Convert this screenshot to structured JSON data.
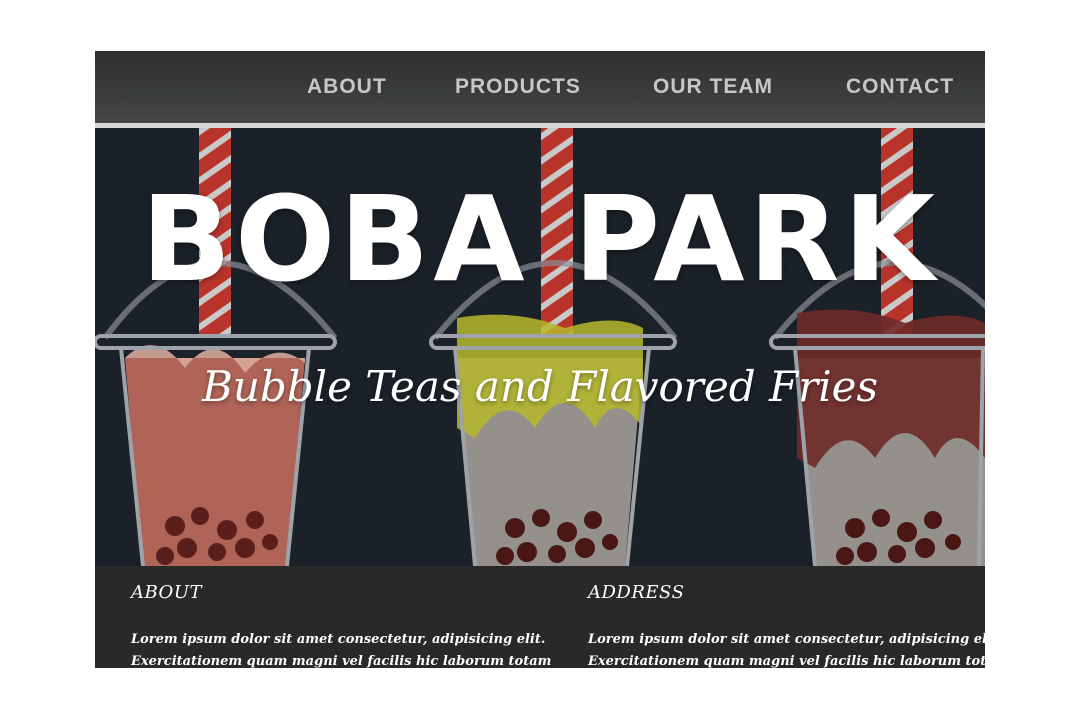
{
  "nav": {
    "items": [
      {
        "label": "ABOUT"
      },
      {
        "label": "PRODUCTS"
      },
      {
        "label": "OUR TEAM"
      },
      {
        "label": "CONTACT"
      }
    ]
  },
  "hero": {
    "title": "BOBA PARK",
    "tagline": "Bubble Teas and Flavored Fries",
    "cups": [
      {
        "flavor": "strawberry",
        "color": "#c9705f"
      },
      {
        "flavor": "matcha",
        "color": "#b6b92a"
      },
      {
        "flavor": "chocolate",
        "color": "#6e2a27"
      }
    ]
  },
  "footer": {
    "about": {
      "heading": "ABOUT",
      "line1": "Lorem ipsum dolor sit amet consectetur, adipisicing elit.",
      "line2": "Exercitationem quam magni vel facilis hic laborum totam"
    },
    "address": {
      "heading": "ADDRESS",
      "line1": "Lorem ipsum dolor sit amet consectetur, adipisicing elit.",
      "line2": "Exercitationem quam magni vel facilis hic laborum totam"
    }
  },
  "colors": {
    "nav_bg": "#3a3d3b",
    "hero_bg": "#1b2128",
    "footer_bg": "#272a29",
    "straw_red": "#b8342a"
  }
}
